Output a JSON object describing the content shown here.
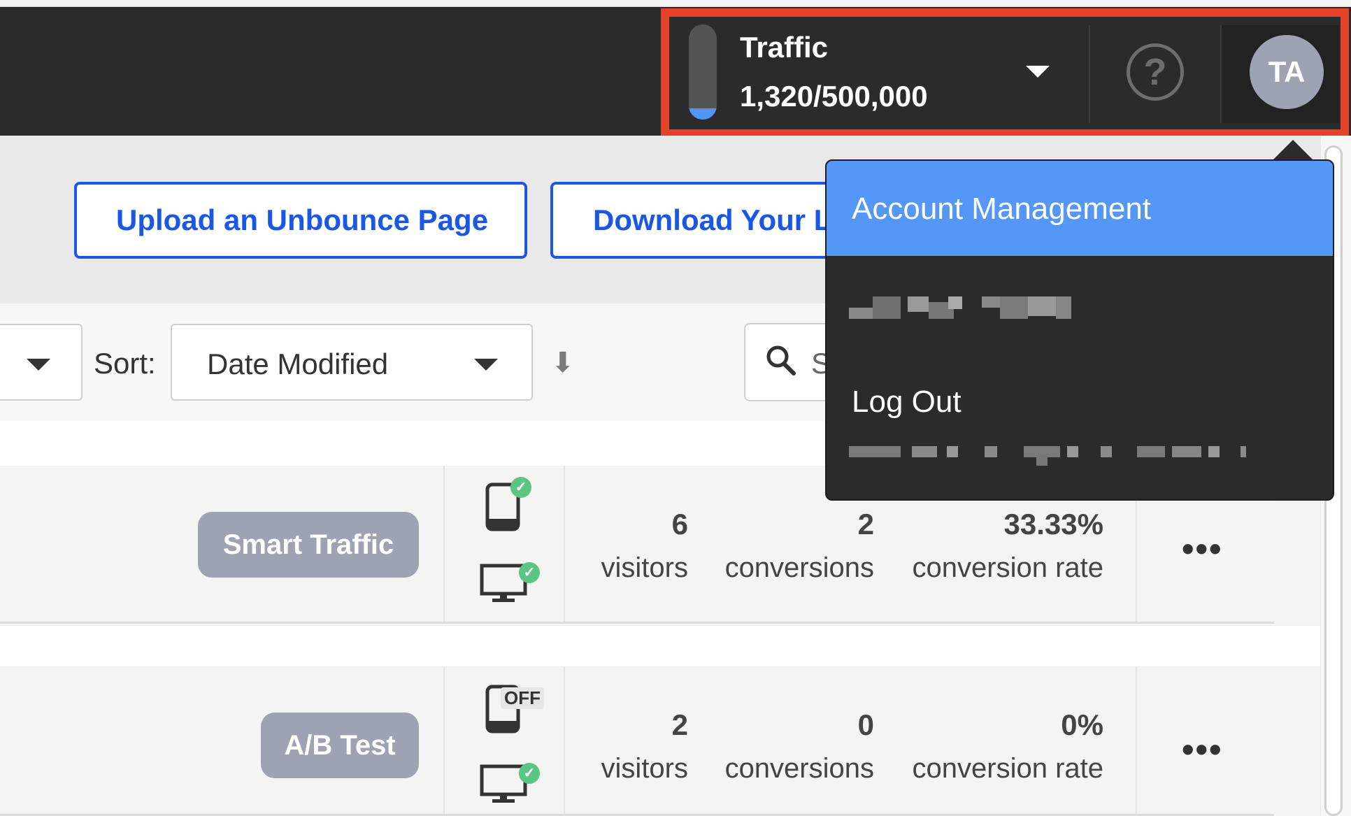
{
  "topbar": {
    "traffic_label": "Traffic",
    "traffic_value": "1,320/500,000",
    "traffic_fraction": 0.00264,
    "help_glyph": "?",
    "avatar_initials": "TA"
  },
  "actions": {
    "upload_label": "Upload an Unbounce Page",
    "download_label": "Download Your L"
  },
  "filters": {
    "sort_label": "Sort:",
    "sort_value": "Date Modified",
    "sort_direction_glyph": "⬇",
    "search_placeholder": "S"
  },
  "rows": [
    {
      "badge": "Smart Traffic",
      "mobile_status": "check",
      "desktop_status": "check",
      "visitors": "6",
      "visitors_label": "visitors",
      "conversions": "2",
      "conversions_label": "conversions",
      "rate": "33.33%",
      "rate_label": "conversion rate",
      "more": "•••"
    },
    {
      "badge": "A/B Test",
      "mobile_status": "OFF",
      "desktop_status": "check",
      "visitors": "2",
      "visitors_label": "visitors",
      "conversions": "0",
      "conversions_label": "conversions",
      "rate": "0%",
      "rate_label": "conversion rate",
      "more": "•••"
    }
  ],
  "menu": {
    "active_item": "Account Management",
    "logout_label": "Log Out"
  },
  "colors": {
    "accent_blue": "#1a57e6",
    "menu_active": "#5597f6",
    "highlight_red": "#e5412b",
    "badge_gray": "#9ea3b4",
    "success_green": "#5bc584"
  },
  "icons": [
    "chevron-down-icon",
    "help-icon",
    "search-icon",
    "sort-arrow-icon",
    "mobile-icon",
    "desktop-icon",
    "check-icon",
    "more-icon"
  ]
}
